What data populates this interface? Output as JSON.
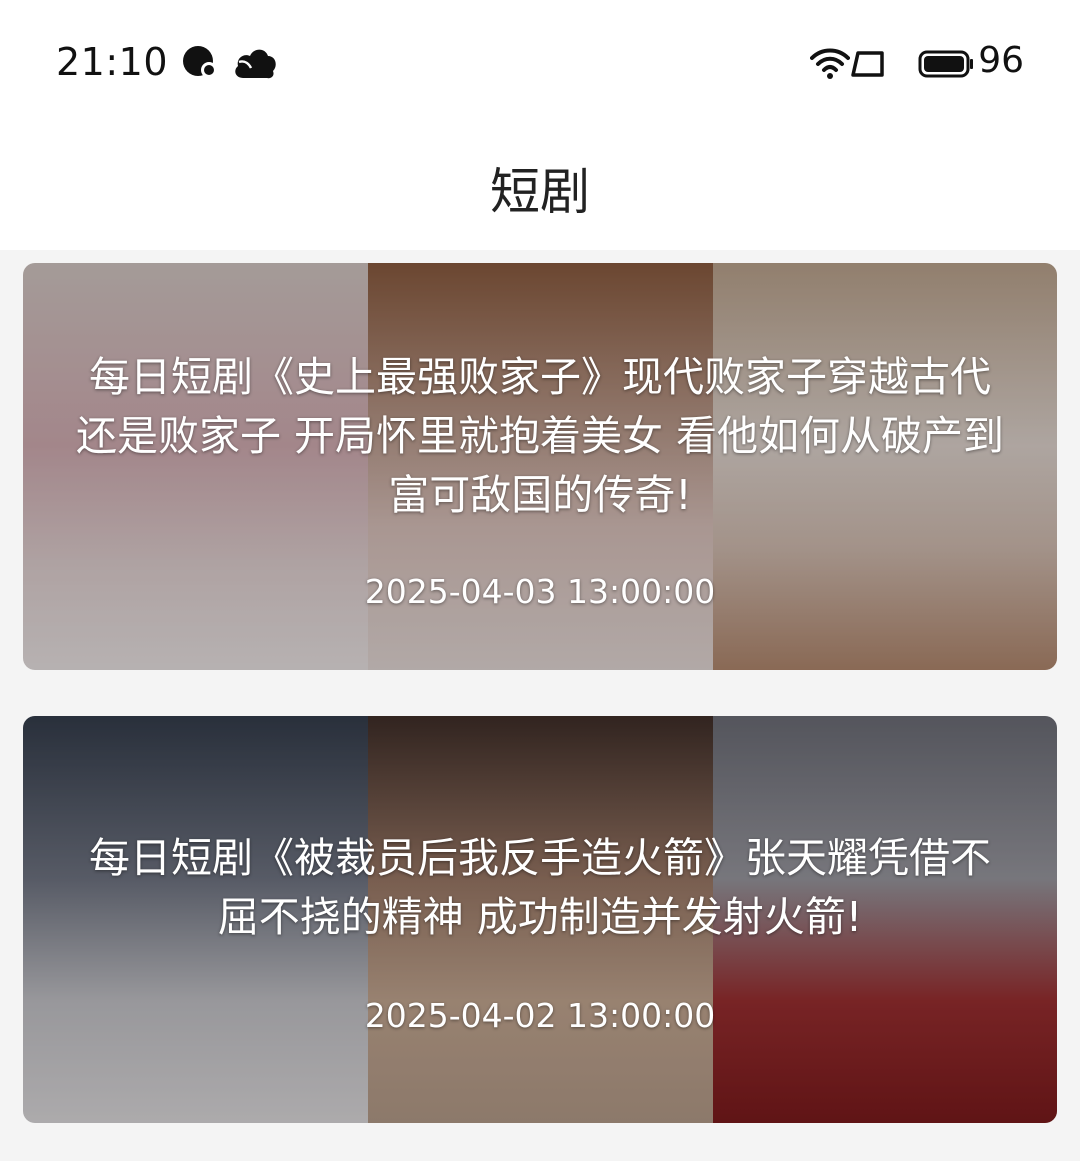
{
  "status_bar": {
    "time": "21:10",
    "battery": "96",
    "icons": [
      "notification-bubble-icon",
      "cloud-notification-icon",
      "wifi-icon",
      "screen-icon",
      "battery-icon"
    ]
  },
  "header": {
    "title": "短剧"
  },
  "articles": [
    {
      "title": "每日短剧《史上最强败家子》现代败家子穿越古代还是败家子 开局怀里就抱着美女 看他如何从破产到富可敌国的传奇!",
      "date": "2025-04-03 13:00:00"
    },
    {
      "title": "每日短剧《被裁员后我反手造火箭》张天耀凭借不屈不挠的精神 成功制造并发射火箭!",
      "date": "2025-04-02 13:00:00"
    }
  ]
}
